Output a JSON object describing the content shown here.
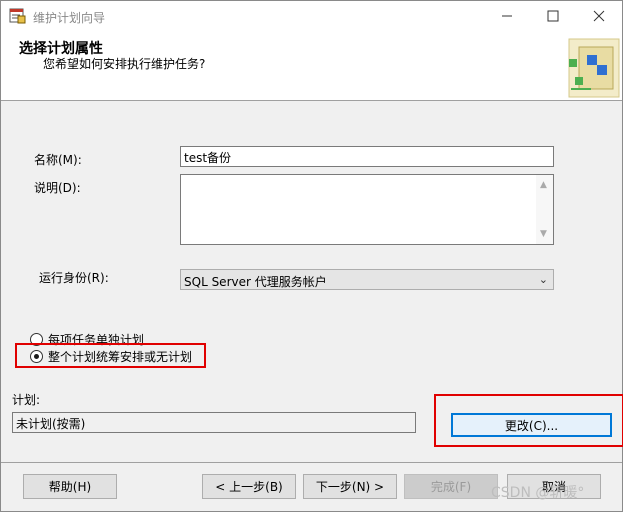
{
  "window": {
    "title": "维护计划向导"
  },
  "header": {
    "title": "选择计划属性",
    "subtitle": "您希望如何安排执行维护任务?"
  },
  "form": {
    "name_label": "名称(M):",
    "name_value": "test备份",
    "desc_label": "说明(D):",
    "desc_value": "",
    "run_as_label": "运行身份(R):",
    "run_as_value": "SQL Server 代理服务帐户"
  },
  "options": {
    "separate_label": "每项任务单独计划",
    "single_label": "整个计划统筹安排或无计划",
    "selected": "single"
  },
  "schedule": {
    "label": "计划:",
    "value": "未计划(按需)",
    "change_button": "更改(C)..."
  },
  "footer": {
    "help": "帮助(H)",
    "back": "< 上一步(B)",
    "next": "下一步(N) >",
    "finish": "完成(F)",
    "cancel": "取消"
  },
  "watermark": "CSDN @斩暖°",
  "colors": {
    "highlight_box": "#e00000",
    "primary_border": "#0078d7"
  },
  "icons": {
    "app": "maintenance-plan-icon",
    "header": "wizard-graphic-icon"
  }
}
